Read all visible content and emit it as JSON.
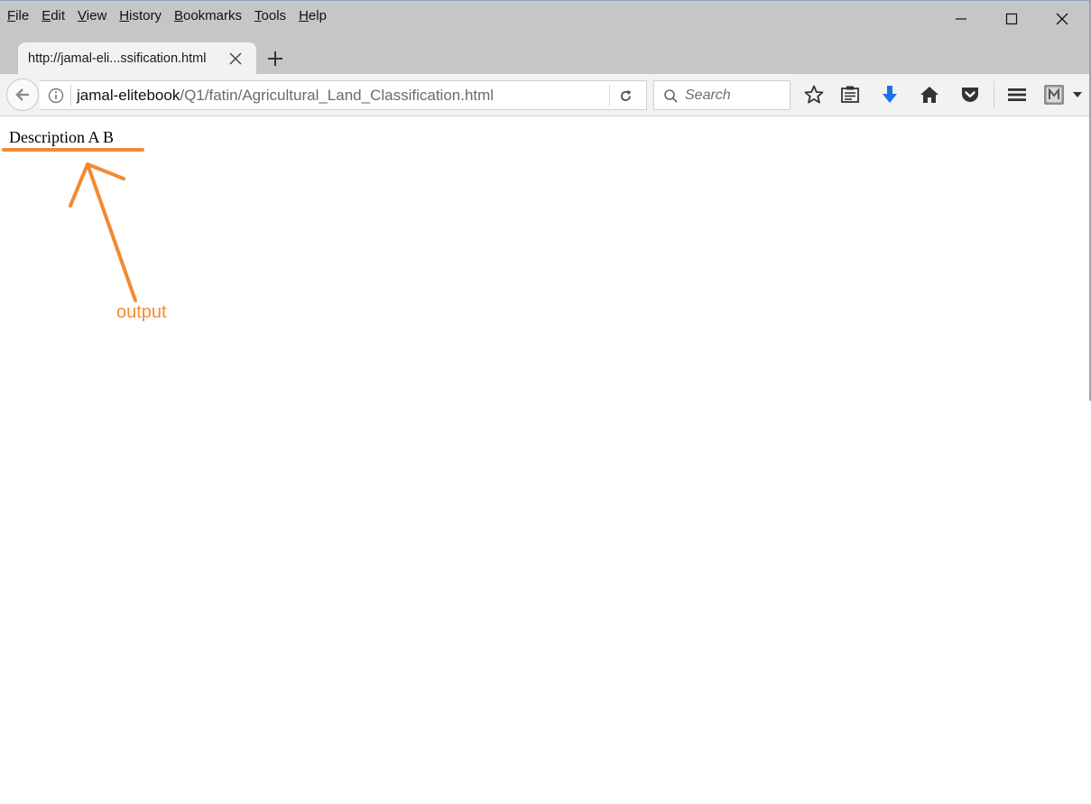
{
  "menu": [
    "File",
    "Edit",
    "View",
    "History",
    "Bookmarks",
    "Tools",
    "Help"
  ],
  "window_controls": [
    "minimize-icon",
    "maximize-icon",
    "close-icon"
  ],
  "tab": {
    "title": "http://jamal-eli...ssification.html"
  },
  "urlbar": {
    "host": "jamal-elitebook",
    "path": "/Q1/fatin/Agricultural_Land_Classification.html"
  },
  "search": {
    "placeholder": "Search"
  },
  "toolbar_icons": [
    "bookmark-star-icon",
    "reading-list-icon",
    "download-icon",
    "home-icon",
    "pocket-icon",
    "menu-icon",
    "extension-icon"
  ],
  "page": {
    "content_text": "Description A B"
  },
  "annotation": {
    "label": "output",
    "color": "#f28a30"
  },
  "colors": {
    "download_accent": "#1a73e8",
    "annotation": "#f28a30"
  }
}
